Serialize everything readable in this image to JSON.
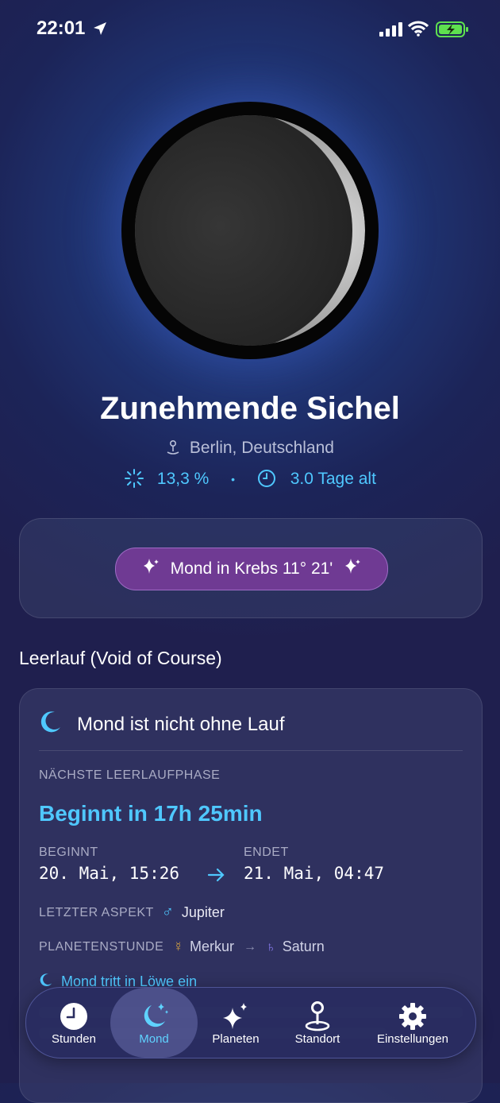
{
  "status_bar": {
    "time": "22:01"
  },
  "moon": {
    "phase_name": "Zunehmende Sichel",
    "location": "Berlin, Deutschland",
    "illumination": "13,3 %",
    "separator": "•",
    "age": "3.0 Tage alt"
  },
  "sign": {
    "label": "Mond in Krebs 11° 21'"
  },
  "void_of_course": {
    "section_title": "Leerlauf (Void of Course)",
    "status": "Mond ist nicht ohne Lauf",
    "next_label": "NÄCHSTE LEERLAUFPHASE",
    "next_value": "Beginnt in 17h 25min",
    "begins_label": "BEGINNT",
    "begins_value": "20. Mai, 15:26",
    "ends_label": "ENDET",
    "ends_value": "21. Mai, 04:47",
    "last_aspect_label": "LETZTER ASPEKT",
    "last_aspect_symbol": "♂",
    "last_aspect_value": "Jupiter",
    "planet_hour_label": "PLANETENSTUNDE",
    "planet_hour_from_symbol": "☿",
    "planet_hour_from": "Merkur",
    "planet_hour_arrow": "→",
    "planet_hour_to_symbol": "♄",
    "planet_hour_to": "Saturn",
    "moon_enters": "Mond tritt in Löwe ein"
  },
  "tabs": [
    {
      "label": "Stunden",
      "icon": "clock-icon",
      "active": false
    },
    {
      "label": "Mond",
      "icon": "moon-stars-icon",
      "active": true
    },
    {
      "label": "Planeten",
      "icon": "sparkles-icon",
      "active": false
    },
    {
      "label": "Standort",
      "icon": "location-pin-icon",
      "active": false
    },
    {
      "label": "Einstellungen",
      "icon": "gear-icon",
      "active": false
    }
  ],
  "colors": {
    "accent": "#4fc8ff",
    "pill": "#6f3a93",
    "background": "#1f1f4e"
  }
}
